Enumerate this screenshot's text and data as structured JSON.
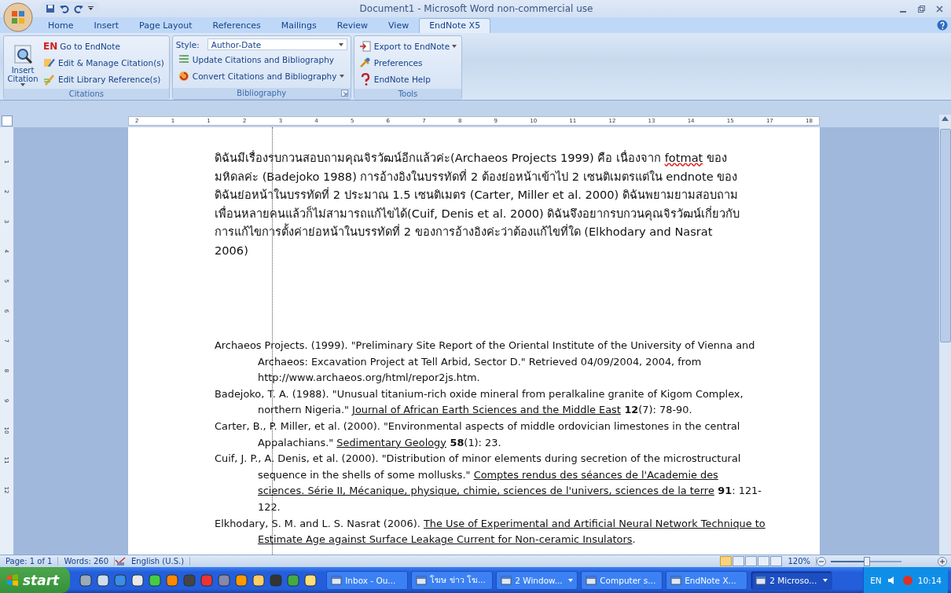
{
  "window": {
    "title": "Document1 - Microsoft Word non-commercial use"
  },
  "ribbon_tabs": [
    {
      "label": "Home",
      "selected": false
    },
    {
      "label": "Insert",
      "selected": false
    },
    {
      "label": "Page Layout",
      "selected": false
    },
    {
      "label": "References",
      "selected": false
    },
    {
      "label": "Mailings",
      "selected": false
    },
    {
      "label": "Review",
      "selected": false
    },
    {
      "label": "View",
      "selected": false
    },
    {
      "label": "EndNote X5",
      "selected": true
    }
  ],
  "ribbon_groups": [
    {
      "name": "Citations",
      "big_button": {
        "label": "Insert Citation",
        "dropdown": true
      },
      "items": [
        {
          "badge": "EN",
          "label": "Go to EndNote",
          "dropdown": false
        },
        {
          "label": "Edit & Manage Citation(s)",
          "dropdown": false
        },
        {
          "label": "Edit Library Reference(s)",
          "dropdown": false
        }
      ]
    },
    {
      "name": "Bibliography",
      "style": {
        "label": "Style:",
        "value": "Author-Date"
      },
      "dialog_launcher": true,
      "items": [
        {
          "label": "Update Citations and Bibliography",
          "dropdown": false
        },
        {
          "label": "Convert Citations and Bibliography",
          "dropdown": true
        }
      ]
    },
    {
      "name": "Tools",
      "items": [
        {
          "label": "Export to EndNote",
          "dropdown": true
        },
        {
          "label": "Preferences",
          "dropdown": false
        },
        {
          "label": "EndNote Help",
          "dropdown": false
        }
      ]
    }
  ],
  "ruler": {
    "horizontal": [
      "2",
      "1",
      "1",
      "2",
      "3",
      "4",
      "5",
      "6",
      "7",
      "8",
      "9",
      "10",
      "11",
      "12",
      "13",
      "14",
      "15",
      "17",
      "18"
    ],
    "vertical": [
      "1",
      "2",
      "3",
      "4",
      "5",
      "6",
      "7",
      "8",
      "9",
      "10",
      "11",
      "12"
    ]
  },
  "document": {
    "paragraph": [
      {
        "text": "ดิฉันมีเรื่องรบกวนสอบถามคุณจิรวัฒน์อีกแล้วค่ะ(Archaeos Projects 1999) คือ เนื่องจาก ",
        "kind": "text"
      },
      {
        "text": "fotmat",
        "kind": "misspelled"
      },
      {
        "text": " ของมหิดลค่ะ (Badejoko 1988) การอ้างอิงในบรรทัดที่ 2 ต้องย่อหน้าเข้าไป 2 เซนติเมตรแต่ใน endnote ของดิฉันย่อหน้าในบรรทัดที่ 2 ประมาณ 1.5 เซนติเมตร (Carter, Miller et al. 2000) ดิฉันพยามยามสอบถามเพื่อนหลายคนแล้วก็ไม่สามารถแก้ไขได้(Cuif, Denis et al. 2000) ดิฉันจึงอยากรบกวนคุณจิรวัฒน์เกี่ยวกับการแก้ไขการตั้งค่าย่อหน้าในบรรทัดที่ 2 ของการอ้างอิงค่ะว่าต้องแก้ไขที่ใด (Elkhodary and Nasrat 2006)",
        "kind": "text"
      }
    ],
    "references": [
      [
        {
          "text": "Archaeos Projects. (1999). \"Preliminary Site Report of the Oriental Institute of the University of Vienna and Archaeos: Excavation Project at Tell Arbid, Sector D.\"   Retrieved 04/09/2004, 2004, from http://www.archaeos.org/html/repor2js.htm.",
          "kind": "text"
        }
      ],
      [
        {
          "text": "Badejoko, T. A. (1988). \"Unusual titanium-rich oxide mineral from peralkaline granite of Kigom Complex, northern Nigeria.\" ",
          "kind": "text"
        },
        {
          "text": "Journal of African Earth Sciences and the Middle East",
          "kind": "title"
        },
        {
          "text": " 12",
          "kind": "volume"
        },
        {
          "text": "(7): 78-90.",
          "kind": "text"
        }
      ],
      [
        {
          "text": "Carter, B., P. Miller, et al. (2000). \"Environmental aspects of middle ordovician limestones in the central Appalachians.\" ",
          "kind": "text"
        },
        {
          "text": "Sedimentary Geology",
          "kind": "title"
        },
        {
          "text": " 58",
          "kind": "volume"
        },
        {
          "text": "(1): 23.",
          "kind": "text"
        }
      ],
      [
        {
          "text": "Cuif, J. P., A. Denis, et al. (2000). \"Distribution of minor elements during secretion of the microstructural sequence in the shells of some mollusks.\" ",
          "kind": "text"
        },
        {
          "text": "Comptes rendus des séances de l'Academie des sciences. Série II, Mécanique, physique, chimie, sciences de l'univers, sciences de la terre",
          "kind": "title"
        },
        {
          "text": " 91",
          "kind": "volume"
        },
        {
          "text": ": 121-122.",
          "kind": "text"
        }
      ],
      [
        {
          "text": "Elkhodary, S. M. and L. S. Nasrat (2006). ",
          "kind": "text"
        },
        {
          "text": "The Use of Experimental and Artificial Neural Network Technique to Estimate Age against Surface Leakage Current for Non-ceramic Insulators",
          "kind": "title"
        },
        {
          "text": ".",
          "kind": "text"
        }
      ]
    ]
  },
  "status_bar": {
    "page": "Page: 1 of 1",
    "words": "Words: 260",
    "language": "English (U.S.)",
    "views": [
      {
        "selected": true
      },
      {
        "selected": false
      },
      {
        "selected": false
      },
      {
        "selected": false
      },
      {
        "selected": false
      }
    ],
    "zoom": "120%",
    "zoom_level": {
      "level": 0.5
    }
  },
  "taskbar": {
    "start": "start",
    "tasks": [
      {
        "label": "Inbox - Ou...",
        "selected": false,
        "grouped": false
      },
      {
        "label": "โฆษ ข่าว โฆ...",
        "selected": false,
        "grouped": false
      },
      {
        "label": "2 Window...",
        "selected": false,
        "grouped": true
      },
      {
        "label": "Computer s...",
        "selected": false,
        "grouped": false
      },
      {
        "label": "EndNote X...",
        "selected": false,
        "grouped": false
      },
      {
        "label": "2 Microso...",
        "selected": true,
        "grouped": true
      }
    ],
    "language": "EN",
    "clock": "10:14"
  }
}
